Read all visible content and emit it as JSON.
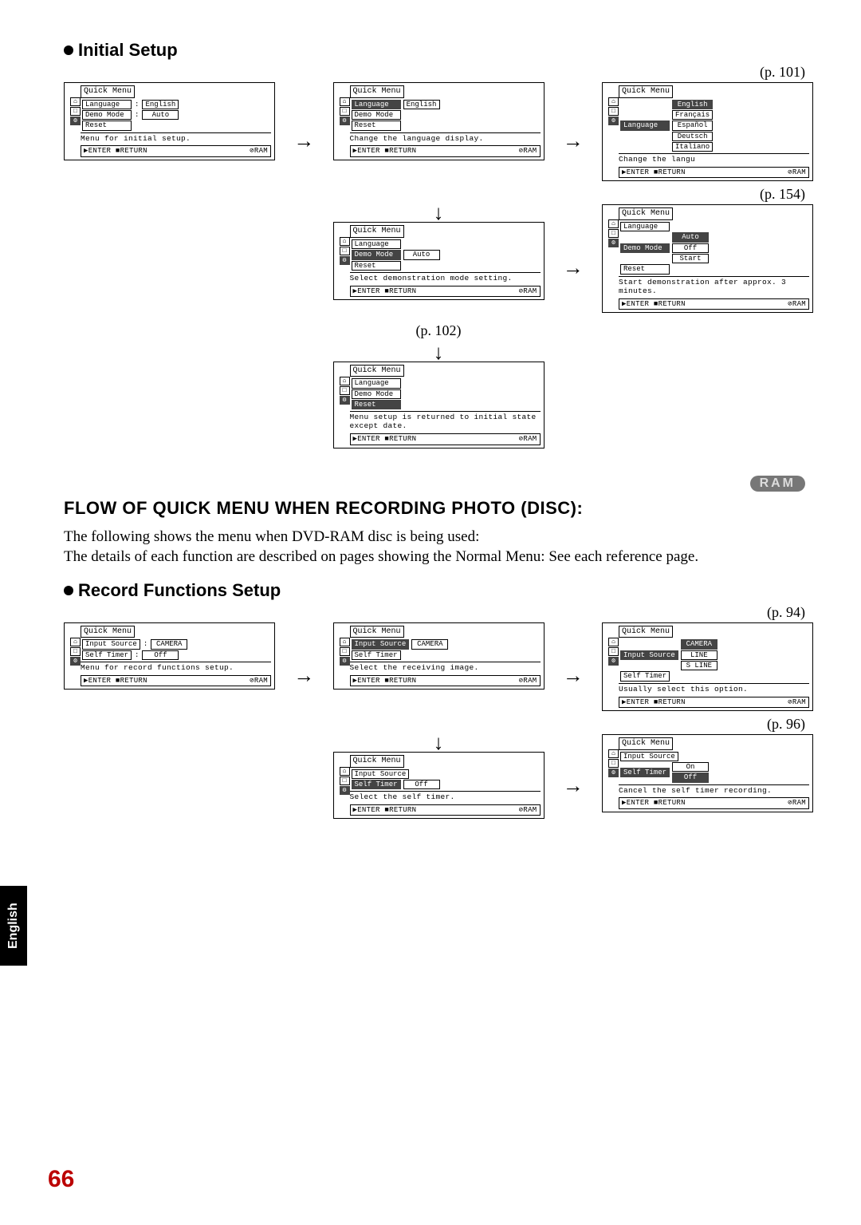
{
  "sections": {
    "initial_setup": "Initial Setup",
    "record_functions": "Record Functions Setup"
  },
  "page_refs": {
    "p101": "(p. 101)",
    "p154": "(p. 154)",
    "p102": "(p. 102)",
    "p94": "(p. 94)",
    "p96": "(p. 96)"
  },
  "flow_title": "FLOW OF QUICK MENU WHEN RECORDING PHOTO (DISC):",
  "body_text": "The following shows the menu when DVD-RAM disc is being used:\nThe details of each function are described on pages showing the Normal Menu: See each reference page.",
  "ram_badge": "RAM",
  "english_tab": "English",
  "page_number": "66",
  "foot": {
    "enter": "▶ENTER",
    "return": "■RETURN",
    "ram": "⊘RAM"
  },
  "menus": {
    "is_a": {
      "title": "Quick Menu",
      "items": [
        {
          "label": "Language",
          "value": "English",
          "sep": ":"
        },
        {
          "label": "Demo Mode",
          "value": "Auto",
          "sep": ":"
        },
        {
          "label": "Reset",
          "value": "",
          "sep": ""
        }
      ],
      "desc": "Menu for initial setup."
    },
    "is_b": {
      "title": "Quick Menu",
      "items": [
        {
          "label": "Language",
          "label_sel": true,
          "value": "English"
        },
        {
          "label": "Demo Mode"
        },
        {
          "label": "Reset"
        }
      ],
      "desc": "Change the language display."
    },
    "is_c": {
      "title": "Quick Menu",
      "items": [
        {
          "label": "Language",
          "label_sel": true,
          "options": [
            {
              "text": "English",
              "sel": true
            },
            {
              "text": "Français"
            },
            {
              "text": "Español"
            },
            {
              "text": "Deutsch"
            },
            {
              "text": "Italiano"
            }
          ]
        }
      ],
      "desc": "Change the langu"
    },
    "is_d": {
      "title": "Quick Menu",
      "items": [
        {
          "label": "Language"
        },
        {
          "label": "Demo Mode",
          "label_sel": true,
          "value": "Auto"
        },
        {
          "label": "Reset"
        }
      ],
      "desc": "Select demonstration mode setting."
    },
    "is_e": {
      "title": "Quick Menu",
      "items": [
        {
          "label": "Language"
        },
        {
          "label": "Demo Mode",
          "label_sel": true,
          "options": [
            {
              "text": "Auto",
              "sel": true
            },
            {
              "text": "Off"
            },
            {
              "text": "Start"
            }
          ]
        },
        {
          "label": "Reset"
        }
      ],
      "desc": "Start demonstration after approx. 3 minutes."
    },
    "is_f": {
      "title": "Quick Menu",
      "items": [
        {
          "label": "Language"
        },
        {
          "label": "Demo Mode"
        },
        {
          "label": "Reset",
          "label_sel": true
        }
      ],
      "desc": "Menu setup is returned to initial state except date."
    },
    "rf_a": {
      "title": "Quick Menu",
      "items": [
        {
          "label": "Input Source",
          "value": "CAMERA",
          "sep": ":"
        },
        {
          "label": "Self Timer",
          "value": "Off",
          "sep": ":"
        }
      ],
      "desc": "Menu for record functions setup."
    },
    "rf_b": {
      "title": "Quick Menu",
      "items": [
        {
          "label": "Input Source",
          "label_sel": true,
          "value": "CAMERA"
        },
        {
          "label": "Self Timer"
        }
      ],
      "desc": "Select the receiving image."
    },
    "rf_c": {
      "title": "Quick Menu",
      "items": [
        {
          "label": "Input Source",
          "label_sel": true,
          "options": [
            {
              "text": "CAMERA",
              "sel": true
            },
            {
              "text": "LINE"
            },
            {
              "text": "S LINE"
            }
          ]
        },
        {
          "label": "Self Timer"
        }
      ],
      "desc": "Usually select this option."
    },
    "rf_d": {
      "title": "Quick Menu",
      "items": [
        {
          "label": "Input Source"
        },
        {
          "label": "Self Timer",
          "label_sel": true,
          "value": "Off"
        }
      ],
      "desc": "Select the self timer."
    },
    "rf_e": {
      "title": "Quick Menu",
      "items": [
        {
          "label": "Input Source"
        },
        {
          "label": "Self Timer",
          "label_sel": true,
          "options": [
            {
              "text": "On"
            },
            {
              "text": "Off",
              "sel": true
            }
          ]
        }
      ],
      "desc": "Cancel the self timer recording."
    }
  }
}
